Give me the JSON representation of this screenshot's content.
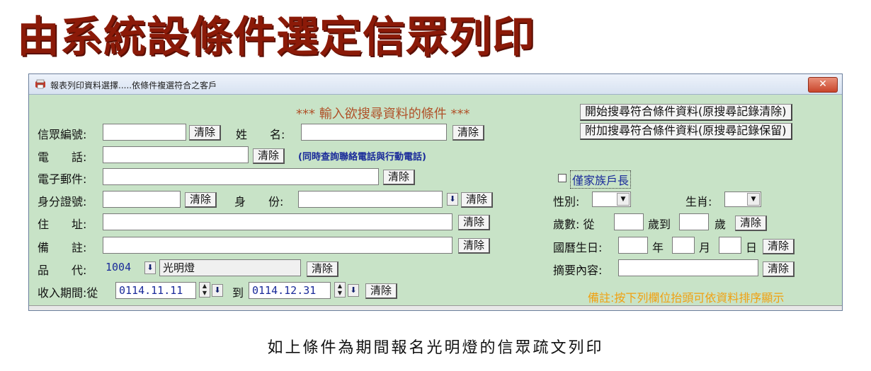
{
  "heading": "由系統設條件選定信眾列印",
  "window": {
    "title": "報表列印資料選擇.....依條件複選符合之客戶",
    "close_label": "✕"
  },
  "form": {
    "header": "*** 輸入欲搜尋資料的條件 ***",
    "start_search_label": "開始搜尋符合條件資料(原搜尋記錄清除)",
    "append_search_label": "附加搜尋符合條件資料(原搜尋記錄保留)",
    "clear_label": "清除",
    "member_no_label": "信眾編號:",
    "name_label": "姓　　名:",
    "phone_label": "電　　話:",
    "phone_note": "(同時查詢聯絡電話與行動電話)",
    "email_label": "電子郵件:",
    "id_label": "身分證號:",
    "identity_label": "身　　份:",
    "address_label": "住　　址:",
    "remark_label": "備　　註:",
    "item_label": "品　　代:",
    "item_code": "1004",
    "item_name": "光明燈",
    "period_label": "收入期間:從",
    "period_from": "0114.11.11",
    "period_to_label": "到",
    "period_to": "0114.12.31",
    "household_head_label": "僅家族戶長",
    "gender_label": "性別:",
    "zodiac_label": "生肖:",
    "age_label": "歲數: 從",
    "age_to_label": "歲到",
    "age_unit": "歲",
    "birthday_label": "國曆生日:",
    "year_label": "年",
    "month_label": "月",
    "day_label": "日",
    "summary_label": "摘要內容:",
    "note": "備註:按下列欄位抬頭可依資料排序顯示"
  },
  "caption": "如上條件為期間報名光明燈的信眾疏文列印",
  "colors": {
    "heading": "#8b1a08",
    "form_bg": "#c8e3c7",
    "header_text": "#b0522a",
    "label_blue": "#1a2b9a",
    "note_orange": "#f0a010"
  }
}
